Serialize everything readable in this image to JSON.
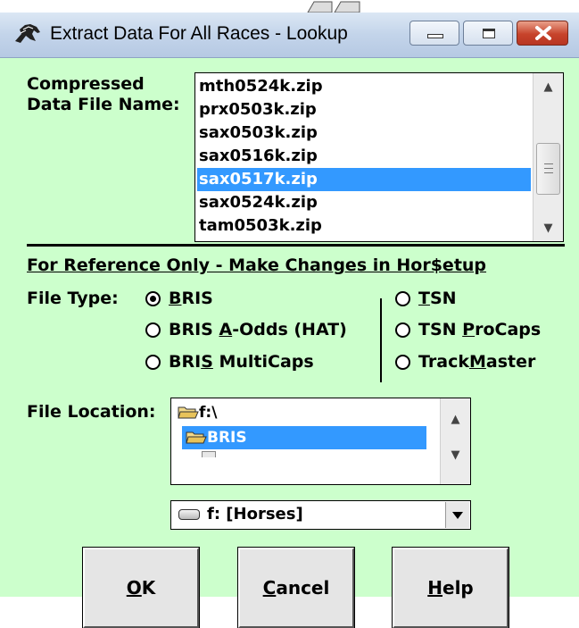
{
  "window": {
    "title": "Extract Data For All Races - Lookup",
    "icon": "horse-head-icon",
    "controls": [
      "minimize-icon",
      "maximize-icon",
      "close-icon"
    ]
  },
  "file_list": {
    "label_line1": "Compressed",
    "label_line2": "Data File Name:",
    "items": [
      "mth0524k.zip",
      "prx0503k.zip",
      "sax0503k.zip",
      "sax0516k.zip",
      "sax0517k.zip",
      "sax0524k.zip",
      "tam0503k.zip"
    ],
    "selected": "sax0517k.zip"
  },
  "reference": {
    "heading": "For Reference Only - Make Changes in Hor$etup"
  },
  "file_type": {
    "label": "File Type:",
    "options": [
      {
        "pre": "",
        "mn": "B",
        "post": "RIS",
        "checked": true
      },
      {
        "pre": "BRIS ",
        "mn": "A",
        "post": "-Odds (HAT)",
        "checked": false
      },
      {
        "pre": "BRI",
        "mn": "S",
        "post": " MultiCaps",
        "checked": false
      },
      {
        "pre": "",
        "mn": "T",
        "post": "SN",
        "checked": false
      },
      {
        "pre": "TSN ",
        "mn": "P",
        "post": "roCaps",
        "checked": false
      },
      {
        "pre": "Track",
        "mn": "M",
        "post": "aster",
        "checked": false
      }
    ]
  },
  "file_location": {
    "label": "File Location:",
    "dirs": [
      "f:\\",
      "BRIS"
    ],
    "selected": "BRIS",
    "drive": "f: [Horses]"
  },
  "buttons": {
    "ok": {
      "mn": "O",
      "rest": "K"
    },
    "cancel": {
      "mn": "C",
      "rest": "ancel"
    },
    "help": {
      "mn": "H",
      "rest": "elp"
    }
  },
  "colors": {
    "client_bg": "#ccffcc",
    "selection": "#3399ff",
    "close_button": "#c7432b"
  }
}
